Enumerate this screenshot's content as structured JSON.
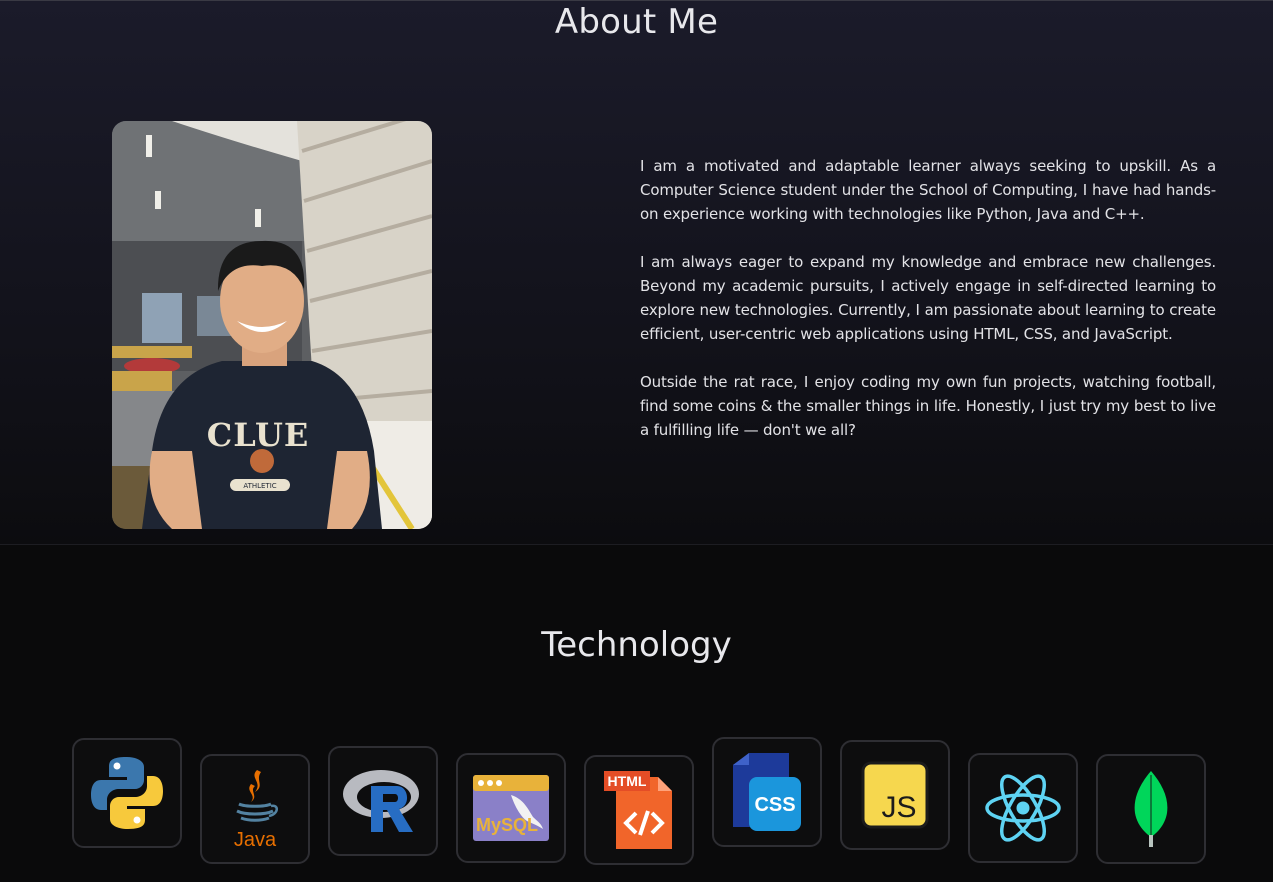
{
  "about": {
    "title": "About Me",
    "paragraphs": [
      "I am a motivated and adaptable learner always seeking to upskill. As a Computer Science student under the School of Computing, I have had hands-on experience working with technologies like Python, Java and C++.",
      "I am always eager to expand my knowledge and embrace new challenges. Beyond my academic pursuits, I actively engage in self-directed learning to explore new technologies. Currently, I am passionate about learning to create efficient, user-centric web applications using HTML, CSS, and JavaScript.",
      "Outside the rat race, I enjoy coding my own fun projects, watching football, find some coins & the smaller things in life. Honestly, I just try my best to live a fulfilling life — don't we all?"
    ],
    "photo": {
      "shirt_text": "CLUE",
      "shirt_subtext": "ATHLETIC"
    }
  },
  "technology": {
    "title": "Technology",
    "items": [
      {
        "icon": "python-icon",
        "label": ""
      },
      {
        "icon": "java-icon",
        "label": "Java"
      },
      {
        "icon": "r-icon",
        "label": "R"
      },
      {
        "icon": "mysql-icon",
        "label": "MySQL"
      },
      {
        "icon": "html-icon",
        "label": "HTML"
      },
      {
        "icon": "css-icon",
        "label": "CSS"
      },
      {
        "icon": "javascript-icon",
        "label": "JS"
      },
      {
        "icon": "react-icon",
        "label": ""
      },
      {
        "icon": "mongodb-icon",
        "label": ""
      }
    ]
  },
  "colors": {
    "background": "#0a0a0b",
    "about_gradient_top": "#1b1b2a",
    "tile_border": "#2e2e33",
    "text": "#e2e2e6"
  }
}
